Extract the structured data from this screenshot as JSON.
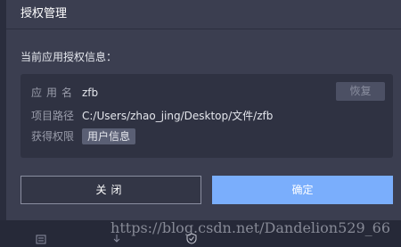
{
  "dialog": {
    "title": "授权管理",
    "section_label": "当前应用授权信息："
  },
  "info": {
    "app_name_key": "应用名",
    "app_name_value": "zfb",
    "path_key": "项目路径",
    "path_value": "C:/Users/zhao_jing/Desktop/文件/zfb",
    "permission_key": "获得权限",
    "permission_tag": "用户信息",
    "restore_label": "恢复"
  },
  "buttons": {
    "close_label": "关闭",
    "ok_label": "确定"
  },
  "bottom_bar": {
    "icons": [
      "document-icon",
      "download-icon",
      "shield-icon"
    ]
  },
  "watermark": "https://blog.csdn.net/Dandelion529_66",
  "colors": {
    "background": "#2a2d3d",
    "dialog": "#3b3e50",
    "info_box": "#2f3242",
    "primary_button": "#7aaefc"
  }
}
